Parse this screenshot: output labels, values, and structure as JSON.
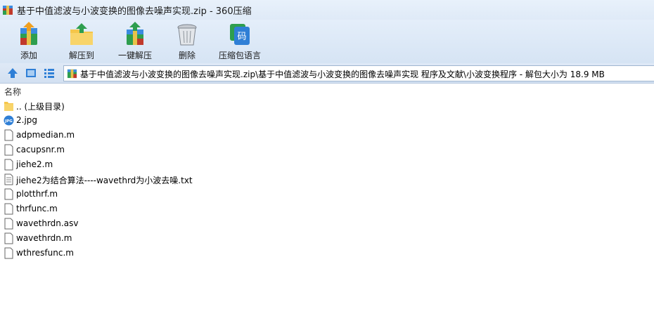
{
  "window": {
    "title": "基于中值滤波与小波变换的图像去噪声实现.zip - 360压缩"
  },
  "toolbar": {
    "items": [
      {
        "label": "添加",
        "icon": "add-archive-icon"
      },
      {
        "label": "解压到",
        "icon": "extract-to-folder-icon"
      },
      {
        "label": "一键解压",
        "icon": "one-click-extract-icon"
      },
      {
        "label": "删除",
        "icon": "trash-bin-icon"
      },
      {
        "label": "压缩包语言",
        "icon": "language-code-icon"
      }
    ],
    "language_badge": "码"
  },
  "address": {
    "path": "基于中值滤波与小波变换的图像去噪声实现.zip\\基于中值滤波与小波变换的图像去噪声实现 程序及文献\\小波变换程序 - 解包大小为 18.9 MB"
  },
  "list": {
    "header_name": "名称",
    "files": [
      {
        "name": ".. (上级目录)",
        "type": "folder"
      },
      {
        "name": "2.jpg",
        "type": "jpg",
        "badge": "JPG"
      },
      {
        "name": "adpmedian.m",
        "type": "file"
      },
      {
        "name": "cacupsnr.m",
        "type": "file"
      },
      {
        "name": "jiehe2.m",
        "type": "file"
      },
      {
        "name": "jiehe2为结合算法----wavethrd为小波去噪.txt",
        "type": "txt"
      },
      {
        "name": "plotthrf.m",
        "type": "file"
      },
      {
        "name": "thrfunc.m",
        "type": "file"
      },
      {
        "name": "wavethrdn.asv",
        "type": "file"
      },
      {
        "name": "wavethrdn.m",
        "type": "file"
      },
      {
        "name": "wthresfunc.m",
        "type": "file"
      }
    ]
  },
  "colors": {
    "accent": "#2f7fd6",
    "folder": "#f5c64a",
    "titlebar": "#e8f1fb"
  }
}
